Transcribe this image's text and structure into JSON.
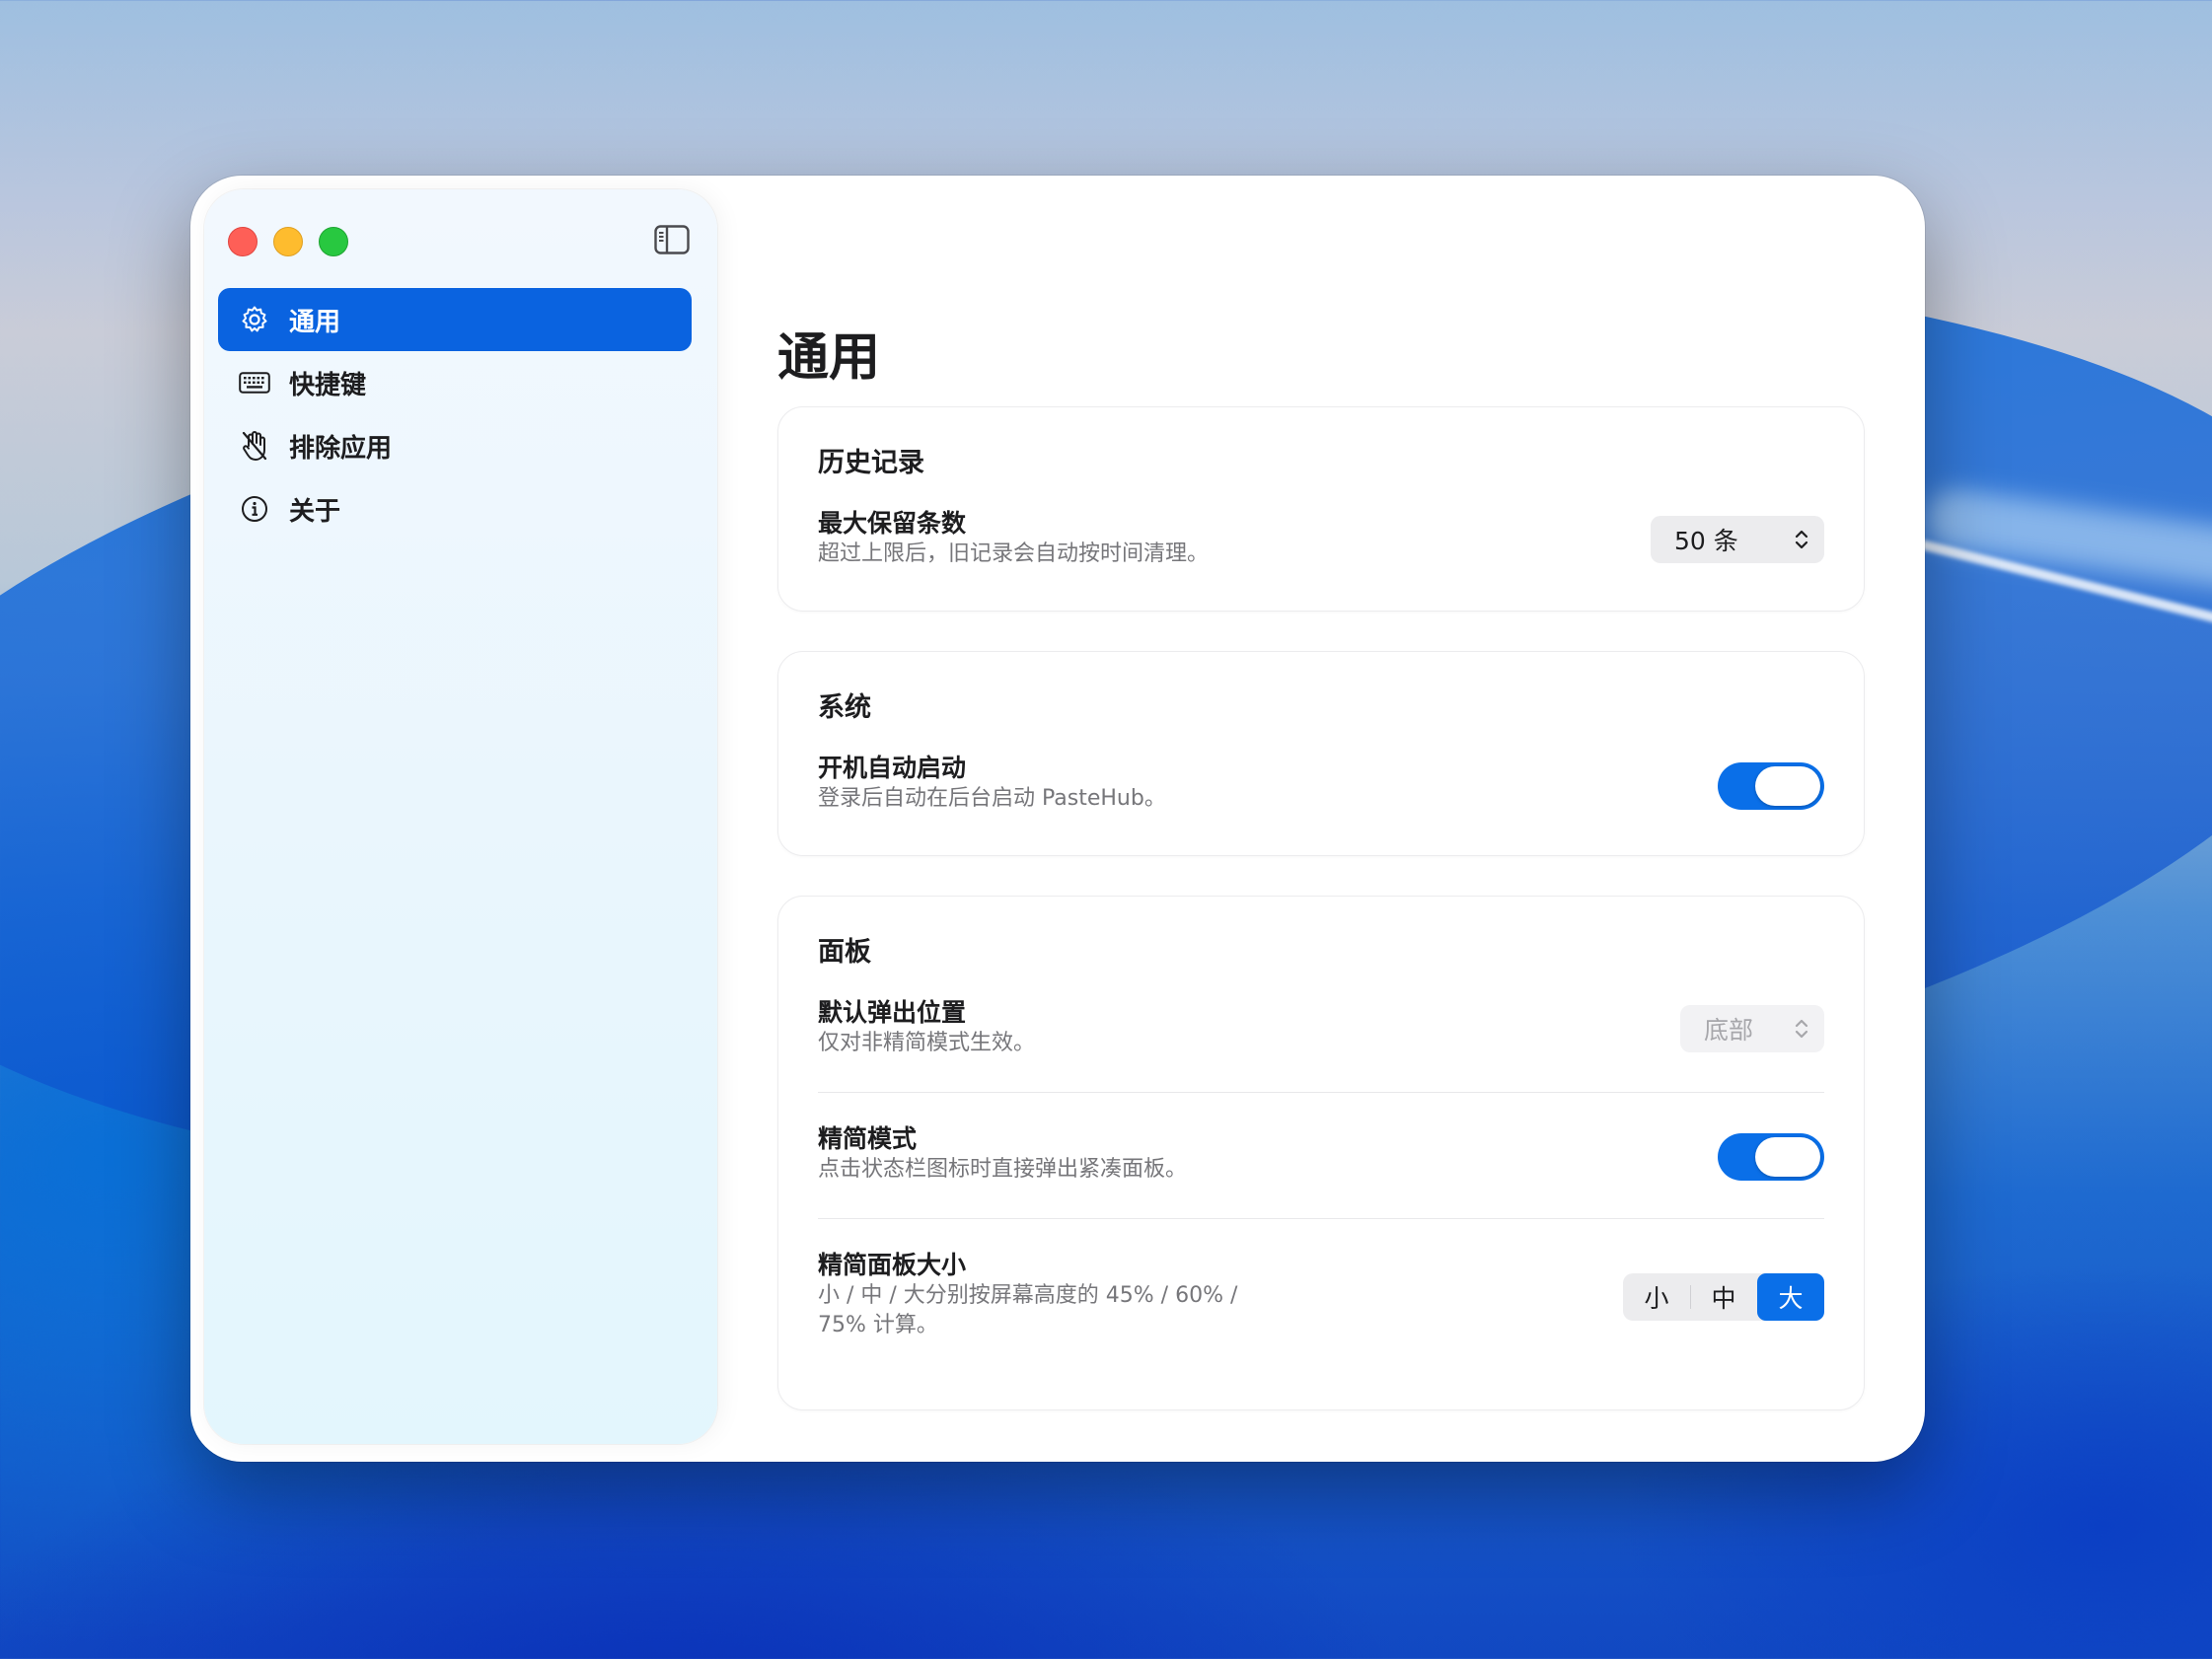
{
  "sidebar": {
    "items": [
      {
        "label": "通用",
        "icon": "gear-icon",
        "active": true
      },
      {
        "label": "快捷键",
        "icon": "keyboard-icon",
        "active": false
      },
      {
        "label": "排除应用",
        "icon": "hand-raised-slash-icon",
        "active": false
      },
      {
        "label": "关于",
        "icon": "info-circle-icon",
        "active": false
      }
    ]
  },
  "main": {
    "title": "通用",
    "history": {
      "title": "历史记录",
      "max_entries": {
        "label": "最大保留条数",
        "desc": "超过上限后，旧记录会自动按时间清理。",
        "value": "50 条"
      }
    },
    "system": {
      "title": "系统",
      "launch_at_login": {
        "label": "开机自动启动",
        "desc": "登录后自动在后台启动 PasteHub。",
        "enabled": true
      }
    },
    "panel": {
      "title": "面板",
      "popup_position": {
        "label": "默认弹出位置",
        "desc": "仅对非精简模式生效。",
        "value": "底部",
        "disabled": true
      },
      "compact_mode": {
        "label": "精简模式",
        "desc": "点击状态栏图标时直接弹出紧凑面板。",
        "enabled": true
      },
      "compact_size": {
        "label": "精简面板大小",
        "desc_line1": "小 / 中 / 大分别按屏幕高度的 45% / 60% /",
        "desc_line2": "75% 计算。",
        "options": [
          "小",
          "中",
          "大"
        ],
        "selected": "大"
      }
    }
  },
  "colors": {
    "accent": "#0a63e0",
    "toggle_on": "#0a6fe8",
    "traffic_red": "#fe5f57",
    "traffic_yellow": "#febc2e",
    "traffic_green": "#28c840"
  }
}
